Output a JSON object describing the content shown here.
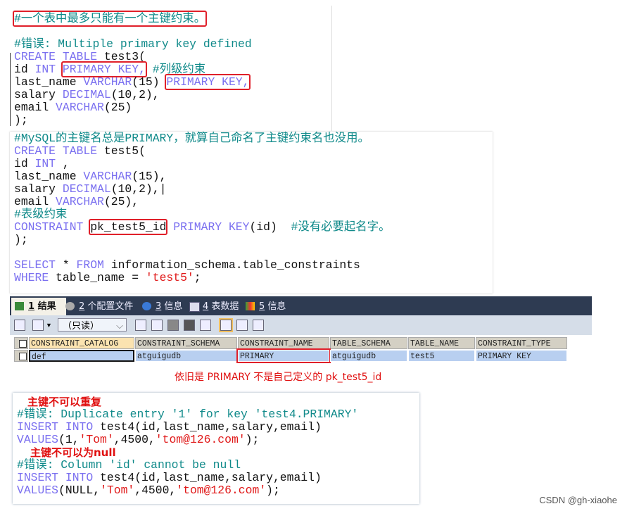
{
  "panel1": {
    "lines": [
      [
        {
          "t": "c",
          "v": "#一个表中最多只能有一个主键约束。",
          "box": true
        }
      ],
      [],
      [
        {
          "t": "c",
          "v": "#错误: Multiple primary key defined"
        }
      ],
      [
        {
          "t": "k",
          "v": "CREATE TABLE"
        },
        {
          "t": "p",
          "v": " test3("
        }
      ],
      [
        {
          "t": "p",
          "v": "id "
        },
        {
          "t": "k",
          "v": "INT"
        },
        {
          "t": "p",
          "v": " "
        },
        {
          "t": "k",
          "v": "PRIMARY KEY,",
          "box": true
        },
        {
          "t": "p",
          "v": " "
        },
        {
          "t": "c",
          "v": "#列级约束"
        }
      ],
      [
        {
          "t": "p",
          "v": "last_name "
        },
        {
          "t": "k",
          "v": "VARCHAR"
        },
        {
          "t": "p",
          "v": "(15) "
        },
        {
          "t": "k",
          "v": "PRIMARY KEY,",
          "box": true
        }
      ],
      [
        {
          "t": "p",
          "v": "salary "
        },
        {
          "t": "k",
          "v": "DECIMAL"
        },
        {
          "t": "p",
          "v": "(10,2),"
        }
      ],
      [
        {
          "t": "p",
          "v": "email "
        },
        {
          "t": "k",
          "v": "VARCHAR"
        },
        {
          "t": "p",
          "v": "(25)"
        }
      ],
      [
        {
          "t": "p",
          "v": ");"
        }
      ]
    ]
  },
  "panel2": {
    "lines": [
      [
        {
          "t": "c",
          "v": "#MySQL的主键名总是PRIMARY，就算自己命名了主键约束名也没用。"
        }
      ],
      [
        {
          "t": "k",
          "v": "CREATE TABLE"
        },
        {
          "t": "p",
          "v": " test5("
        }
      ],
      [
        {
          "t": "p",
          "v": "id "
        },
        {
          "t": "k",
          "v": "INT"
        },
        {
          "t": "p",
          "v": " ,"
        }
      ],
      [
        {
          "t": "p",
          "v": "last_name "
        },
        {
          "t": "k",
          "v": "VARCHAR"
        },
        {
          "t": "p",
          "v": "(15),"
        }
      ],
      [
        {
          "t": "p",
          "v": "salary "
        },
        {
          "t": "k",
          "v": "DECIMAL"
        },
        {
          "t": "p",
          "v": "(10,2),|"
        }
      ],
      [
        {
          "t": "p",
          "v": "email "
        },
        {
          "t": "k",
          "v": "VARCHAR"
        },
        {
          "t": "p",
          "v": "(25),"
        }
      ],
      [
        {
          "t": "c",
          "v": "#表级约束"
        }
      ],
      [
        {
          "t": "k",
          "v": "CONSTRAINT"
        },
        {
          "t": "p",
          "v": " "
        },
        {
          "t": "p",
          "v": "pk_test5_id",
          "box": true
        },
        {
          "t": "p",
          "v": " "
        },
        {
          "t": "k",
          "v": "PRIMARY KEY"
        },
        {
          "t": "p",
          "v": "(id)  "
        },
        {
          "t": "c",
          "v": "#没有必要起名字。"
        }
      ],
      [
        {
          "t": "p",
          "v": ");"
        }
      ],
      [],
      [
        {
          "t": "k",
          "v": "SELECT"
        },
        {
          "t": "p",
          "v": " * "
        },
        {
          "t": "k",
          "v": "FROM"
        },
        {
          "t": "p",
          "v": " information_schema.table_constraints"
        }
      ],
      [
        {
          "t": "k",
          "v": "WHERE"
        },
        {
          "t": "p",
          "v": " table_name = "
        },
        {
          "t": "s",
          "v": "'test5'"
        },
        {
          "t": "p",
          "v": ";"
        }
      ]
    ]
  },
  "results": {
    "tabs": [
      {
        "num": "1",
        "label": "结果",
        "icon": "result-grid-icon",
        "active": true
      },
      {
        "num": "2",
        "label": "个配置文件",
        "icon": "profile-icon"
      },
      {
        "num": "3",
        "label": "信息",
        "icon": "info-icon"
      },
      {
        "num": "4",
        "label": "表数据",
        "icon": "table-data-icon"
      },
      {
        "num": "5",
        "label": "信息",
        "icon": "info-shapes-icon"
      }
    ],
    "mode_select": "（只读）",
    "columns": [
      "CONSTRAINT_CATALOG",
      "CONSTRAINT_SCHEMA",
      "CONSTRAINT_NAME",
      "TABLE_SCHEMA",
      "TABLE_NAME",
      "CONSTRAINT_TYPE"
    ],
    "rows": [
      [
        "def",
        "atguigudb",
        "PRIMARY",
        "atguigudb",
        "test5",
        "PRIMARY KEY"
      ]
    ],
    "annotation": "依旧是 PRIMARY 不是自己定义的 pk_test5_id"
  },
  "panel4": {
    "note1": "主键不可以重复",
    "note2": "主键不可以为null",
    "lines": [
      [
        {
          "t": "c",
          "v": "#错误: Duplicate entry '1' for key 'test4.PRIMARY'"
        }
      ],
      [
        {
          "t": "k",
          "v": "INSERT INTO"
        },
        {
          "t": "p",
          "v": " test4(id,last_name,salary,email)"
        }
      ],
      [
        {
          "t": "k",
          "v": "VALUES"
        },
        {
          "t": "p",
          "v": "(1,"
        },
        {
          "t": "s",
          "v": "'Tom'"
        },
        {
          "t": "p",
          "v": ",4500,"
        },
        {
          "t": "s",
          "v": "'tom@126.com'"
        },
        {
          "t": "p",
          "v": ");"
        }
      ],
      [],
      [
        {
          "t": "c",
          "v": "#错误: Column 'id' cannot be null"
        }
      ],
      [
        {
          "t": "k",
          "v": "INSERT INTO"
        },
        {
          "t": "p",
          "v": " test4(id,last_name,salary,email)"
        }
      ],
      [
        {
          "t": "k",
          "v": "VALUES"
        },
        {
          "t": "p",
          "v": "(NULL,"
        },
        {
          "t": "s",
          "v": "'Tom'"
        },
        {
          "t": "p",
          "v": ",4500,"
        },
        {
          "t": "s",
          "v": "'tom@126.com'"
        },
        {
          "t": "p",
          "v": ");"
        }
      ]
    ]
  },
  "watermark": "CSDN @gh-xiaohe",
  "colors": {
    "comment": "#108a8a",
    "keyword": "#7b70f0",
    "string": "#e01818",
    "highlight_box": "#e0202a",
    "tab_bar": "#2e3b52",
    "row_selected": "#b8cff0"
  }
}
